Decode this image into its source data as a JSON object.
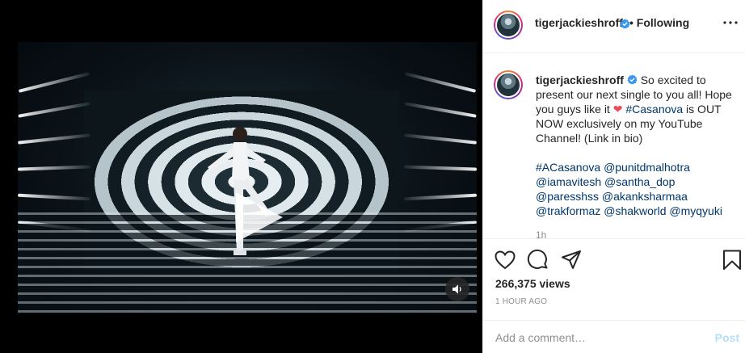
{
  "post": {
    "username": "tigerjackieshroff",
    "follow_separator": "•",
    "follow_status": "Following"
  },
  "caption": {
    "username": "tigerjackieshroff",
    "line1_text": " So excited to present our next single to you all! Hope you guys like it ",
    "heart": "❤",
    "hashtag_casanova": "#Casanova",
    "line1_tail": " is OUT NOW exclusively on my YouTube Channel! (Link in bio)",
    "tags": [
      "#ACasanova",
      "@punitdmalhotra",
      "@iamavitesh",
      "@santha_dop",
      "@paresshss",
      "@akanksharmaa",
      "@trakformaz",
      "@shakworld",
      "@myqyuki"
    ],
    "time_ago": "1h"
  },
  "stats": {
    "views": "266,375 views",
    "posted": "1 HOUR AGO"
  },
  "comment": {
    "placeholder": "Add a comment…",
    "post_label": "Post"
  },
  "icons": {
    "verified": "verified-badge-icon",
    "like": "heart-icon",
    "comment": "comment-icon",
    "share": "share-icon",
    "save": "bookmark-icon",
    "play": "play-icon",
    "sound": "speaker-icon",
    "more": "more-options-icon"
  },
  "colors": {
    "verified_blue": "#3897f0",
    "link": "#00376b",
    "heart_red": "#ed4956",
    "post_disabled": "#b2dffc"
  }
}
